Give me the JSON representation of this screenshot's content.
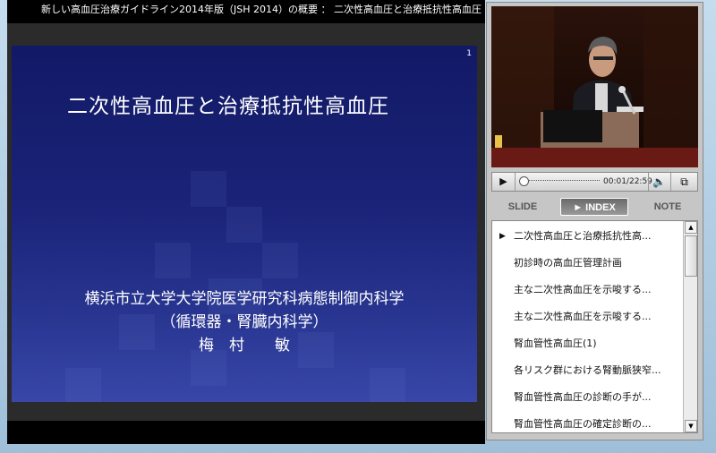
{
  "window": {
    "title": "新しい高血圧治療ガイドライン2014年版（JSH 2014）の概要 ： 二次性高血圧と治療抵抗性高血圧"
  },
  "slide": {
    "number": "1",
    "title": "二次性高血圧と治療抵抗性高血圧",
    "affiliation_line1": "横浜市立大学大学院医学研究科病態制御内科学",
    "affiliation_line2": "（循環器・腎臓内科学）",
    "presenter": "梅　村　　敏",
    "background_color": "#1a2378"
  },
  "player": {
    "play_icon": "play-icon",
    "time": "00:01/22:59",
    "volume_icon": "speaker-icon",
    "popout_icon": "popout-icon",
    "progress": 0.001
  },
  "tabs": {
    "slide": "SLIDE",
    "index": "► INDEX",
    "note": "NOTE",
    "active": "INDEX"
  },
  "index_items": [
    "二次性高血圧と治療抵抗性高...",
    "初診時の高血圧管理計画",
    "主な二次性高血圧を示唆する...",
    "主な二次性高血圧を示唆する...",
    "腎血管性高血圧(1)",
    "各リスク群における腎動脈狭窄...",
    "腎血管性高血圧の診断の手が...",
    "腎血管性高血圧の確定診断の..."
  ]
}
